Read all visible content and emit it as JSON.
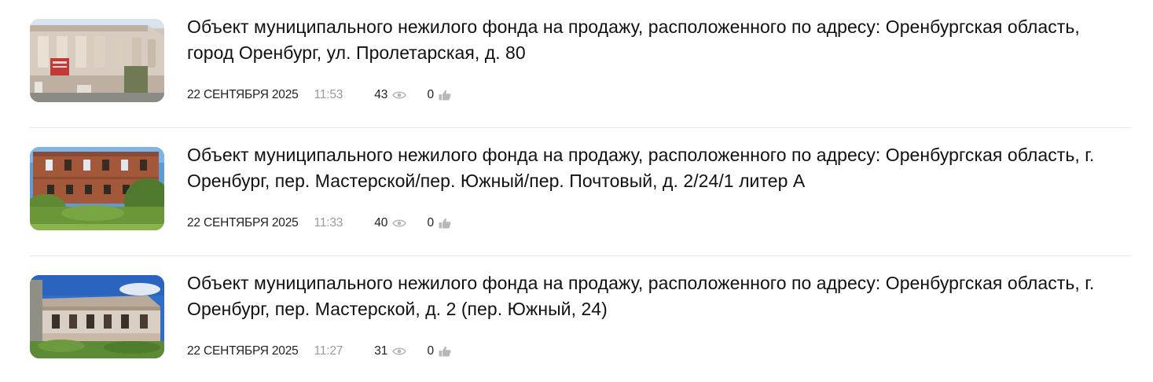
{
  "news": {
    "items": [
      {
        "title": "Объект муниципального нежилого фонда на продажу, расположенного по адресу: Оренбургская область, город Оренбург, ул. Пролетарская, д. 80",
        "date": "22 сентября 2025",
        "time": "11:53",
        "views": "43",
        "likes": "0"
      },
      {
        "title": "Объект муниципального нежилого фонда на продажу, расположенного по адресу: Оренбургская область, г. Оренбург, пер. Мастерской/пер. Южный/пер. Почтовый, д. 2/24/1 литер А",
        "date": "22 сентября 2025",
        "time": "11:33",
        "views": "40",
        "likes": "0"
      },
      {
        "title": "Объект муниципального нежилого фонда на продажу, расположенного по адресу: Оренбургская область, г. Оренбург, пер. Мастерской, д. 2 (пер. Южный, 24)",
        "date": "22 сентября 2025",
        "time": "11:27",
        "views": "31",
        "likes": "0"
      }
    ]
  },
  "icons": {
    "views": "eye-icon",
    "likes": "thumbs-up-icon"
  },
  "colors": {
    "text": "#111111",
    "muted": "#9a9a9a",
    "icon": "#b8b8b8",
    "divider": "#e8e8e8"
  }
}
